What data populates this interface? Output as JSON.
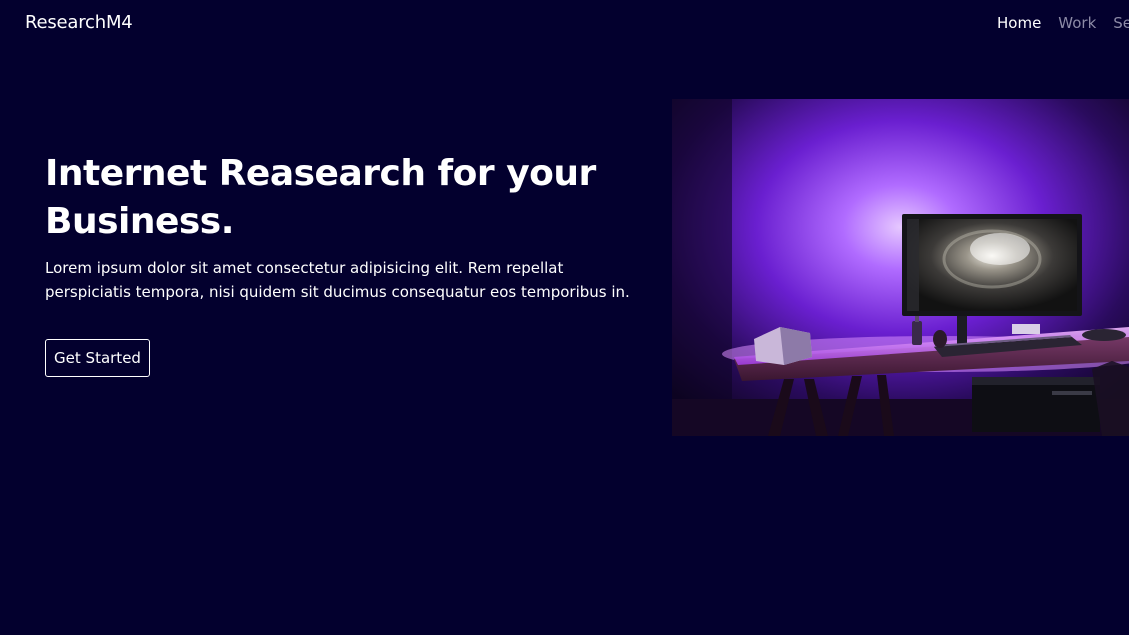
{
  "brand": {
    "name": "ResearchM4"
  },
  "nav": {
    "items": [
      {
        "label": "Home",
        "active": true
      },
      {
        "label": "Work",
        "active": false
      },
      {
        "label": "Ser",
        "active": false
      }
    ]
  },
  "hero": {
    "title": "Internet Reasearch for your Business.",
    "body": "Lorem ipsum dolor sit amet consectetur adipisicing elit. Rem repellat perspiciatis tempora, nisi quidem sit ducimus consequatur eos temporibus in.",
    "cta_label": "Get Started",
    "image_icon": "desk-setup-image"
  },
  "colors": {
    "background": "#03002e",
    "text": "#ffffff",
    "muted": "#8c8aa6",
    "accent": "#8a2be2"
  }
}
